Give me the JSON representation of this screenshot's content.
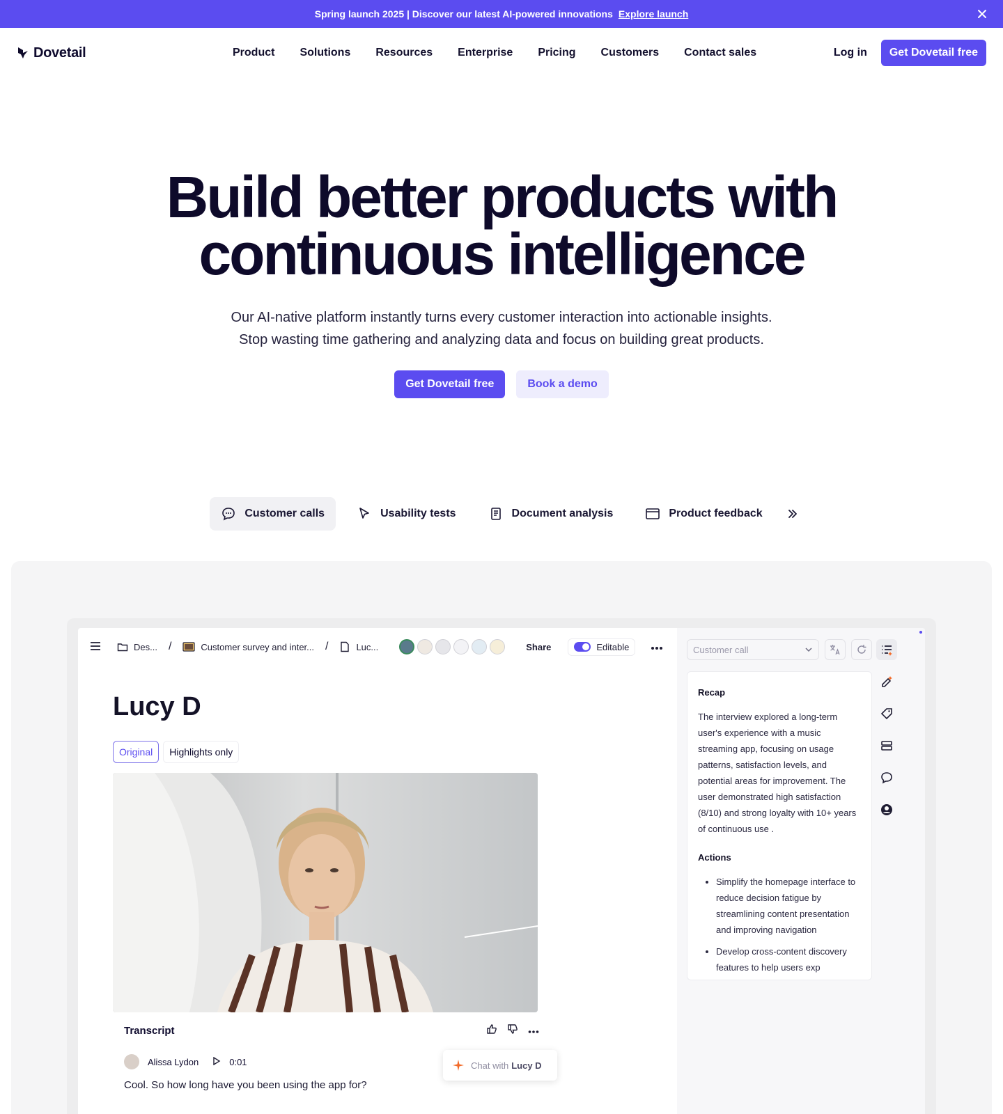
{
  "banner": {
    "text": "Spring launch 2025 | Discover our latest AI-powered innovations",
    "link": "Explore launch"
  },
  "nav": {
    "brand": "Dovetail",
    "links": [
      "Product",
      "Solutions",
      "Resources",
      "Enterprise",
      "Pricing",
      "Customers",
      "Contact sales"
    ],
    "login": "Log in",
    "cta": "Get Dovetail free"
  },
  "hero": {
    "title_line1": "Build better products with",
    "title_line2": "continuous intelligence",
    "subtitle_line1": "Our AI-native platform instantly turns every customer interaction into actionable insights.",
    "subtitle_line2": "Stop wasting time gathering and analyzing data and focus on building great products.",
    "primary_cta": "Get Dovetail free",
    "secondary_cta": "Book a demo"
  },
  "tabs": [
    {
      "label": "Customer calls",
      "icon": "chat-bubble-icon",
      "active": true
    },
    {
      "label": "Usability tests",
      "icon": "cursor-icon",
      "active": false
    },
    {
      "label": "Document analysis",
      "icon": "document-icon",
      "active": false
    },
    {
      "label": "Product feedback",
      "icon": "window-icon",
      "active": false
    }
  ],
  "app": {
    "breadcrumb": [
      "Des...",
      "Customer survey and inter...",
      "Luc..."
    ],
    "share": "Share",
    "editable": "Editable",
    "title": "Lucy D",
    "view_original": "Original",
    "view_highlights": "Highlights only",
    "transcript_label": "Transcript",
    "speaker": "Alissa Lydon",
    "timestamp": "0:01",
    "line": "Cool. So how long have you been using the app for?",
    "chat_prefix": "Chat with",
    "chat_name": "Lucy D"
  },
  "panel": {
    "select_value": "Customer call",
    "recap_heading": "Recap",
    "recap_text": "The interview explored a long-term user's experience with a music streaming app, focusing on usage patterns, satisfaction levels, and potential areas for improvement. The user demonstrated high satisfaction (8/10) and strong loyalty with 10+ years of continuous use .",
    "actions_heading": "Actions",
    "actions": [
      "Simplify the homepage interface to reduce decision fatigue by streamlining content presentation and improving navigation",
      "Develop cross-content discovery features to help users exp"
    ]
  },
  "colors": {
    "accent": "#5b4cf0",
    "ink": "#0e0a2a"
  }
}
